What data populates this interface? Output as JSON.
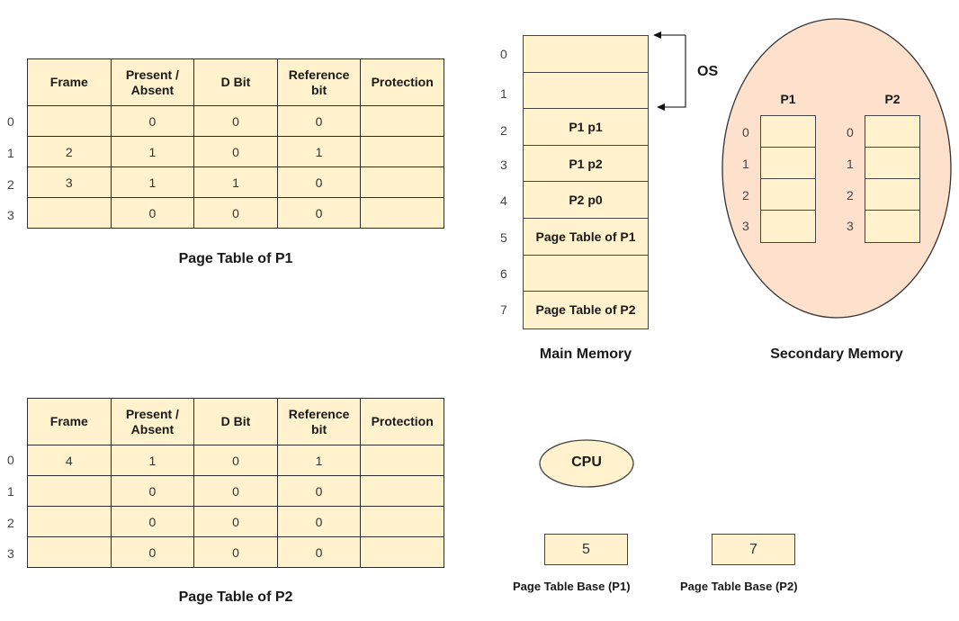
{
  "colors": {
    "cell_fill": "#fff2cc",
    "secondary_memory_fill": "#fde1cc",
    "border": "#2b2b2b"
  },
  "page_table_p1": {
    "caption": "Page Table of P1",
    "headers": [
      "Frame",
      "Present / Absent",
      "D Bit",
      "Reference bit",
      "Protection"
    ],
    "row_indices": [
      "0",
      "1",
      "2",
      "3"
    ],
    "rows": [
      [
        "",
        "0",
        "0",
        "0",
        ""
      ],
      [
        "2",
        "1",
        "0",
        "1",
        ""
      ],
      [
        "3",
        "1",
        "1",
        "0",
        ""
      ],
      [
        "",
        "0",
        "0",
        "0",
        ""
      ]
    ]
  },
  "page_table_p2": {
    "caption": "Page Table of P2",
    "headers": [
      "Frame",
      "Present / Absent",
      "D Bit",
      "Reference bit",
      "Protection"
    ],
    "row_indices": [
      "0",
      "1",
      "2",
      "3"
    ],
    "rows": [
      [
        "4",
        "1",
        "0",
        "1",
        ""
      ],
      [
        "",
        "0",
        "0",
        "0",
        ""
      ],
      [
        "",
        "0",
        "0",
        "0",
        ""
      ],
      [
        "",
        "0",
        "0",
        "0",
        ""
      ]
    ]
  },
  "main_memory": {
    "caption": "Main Memory",
    "os_label": "OS",
    "frame_indices": [
      "0",
      "1",
      "2",
      "3",
      "4",
      "5",
      "6",
      "7"
    ],
    "frames": [
      "",
      "",
      "P1 p1",
      "P1 p2",
      "P2 p0",
      "Page Table of P1",
      "",
      "Page Table of P2"
    ]
  },
  "secondary_memory": {
    "caption": "Secondary Memory",
    "processes": [
      {
        "name": "P1",
        "page_indices": [
          "0",
          "1",
          "2",
          "3"
        ]
      },
      {
        "name": "P2",
        "page_indices": [
          "0",
          "1",
          "2",
          "3"
        ]
      }
    ]
  },
  "cpu": {
    "label": "CPU",
    "registers": [
      {
        "value": "5",
        "label": "Page Table Base (P1)"
      },
      {
        "value": "7",
        "label": "Page Table Base (P2)"
      }
    ]
  }
}
